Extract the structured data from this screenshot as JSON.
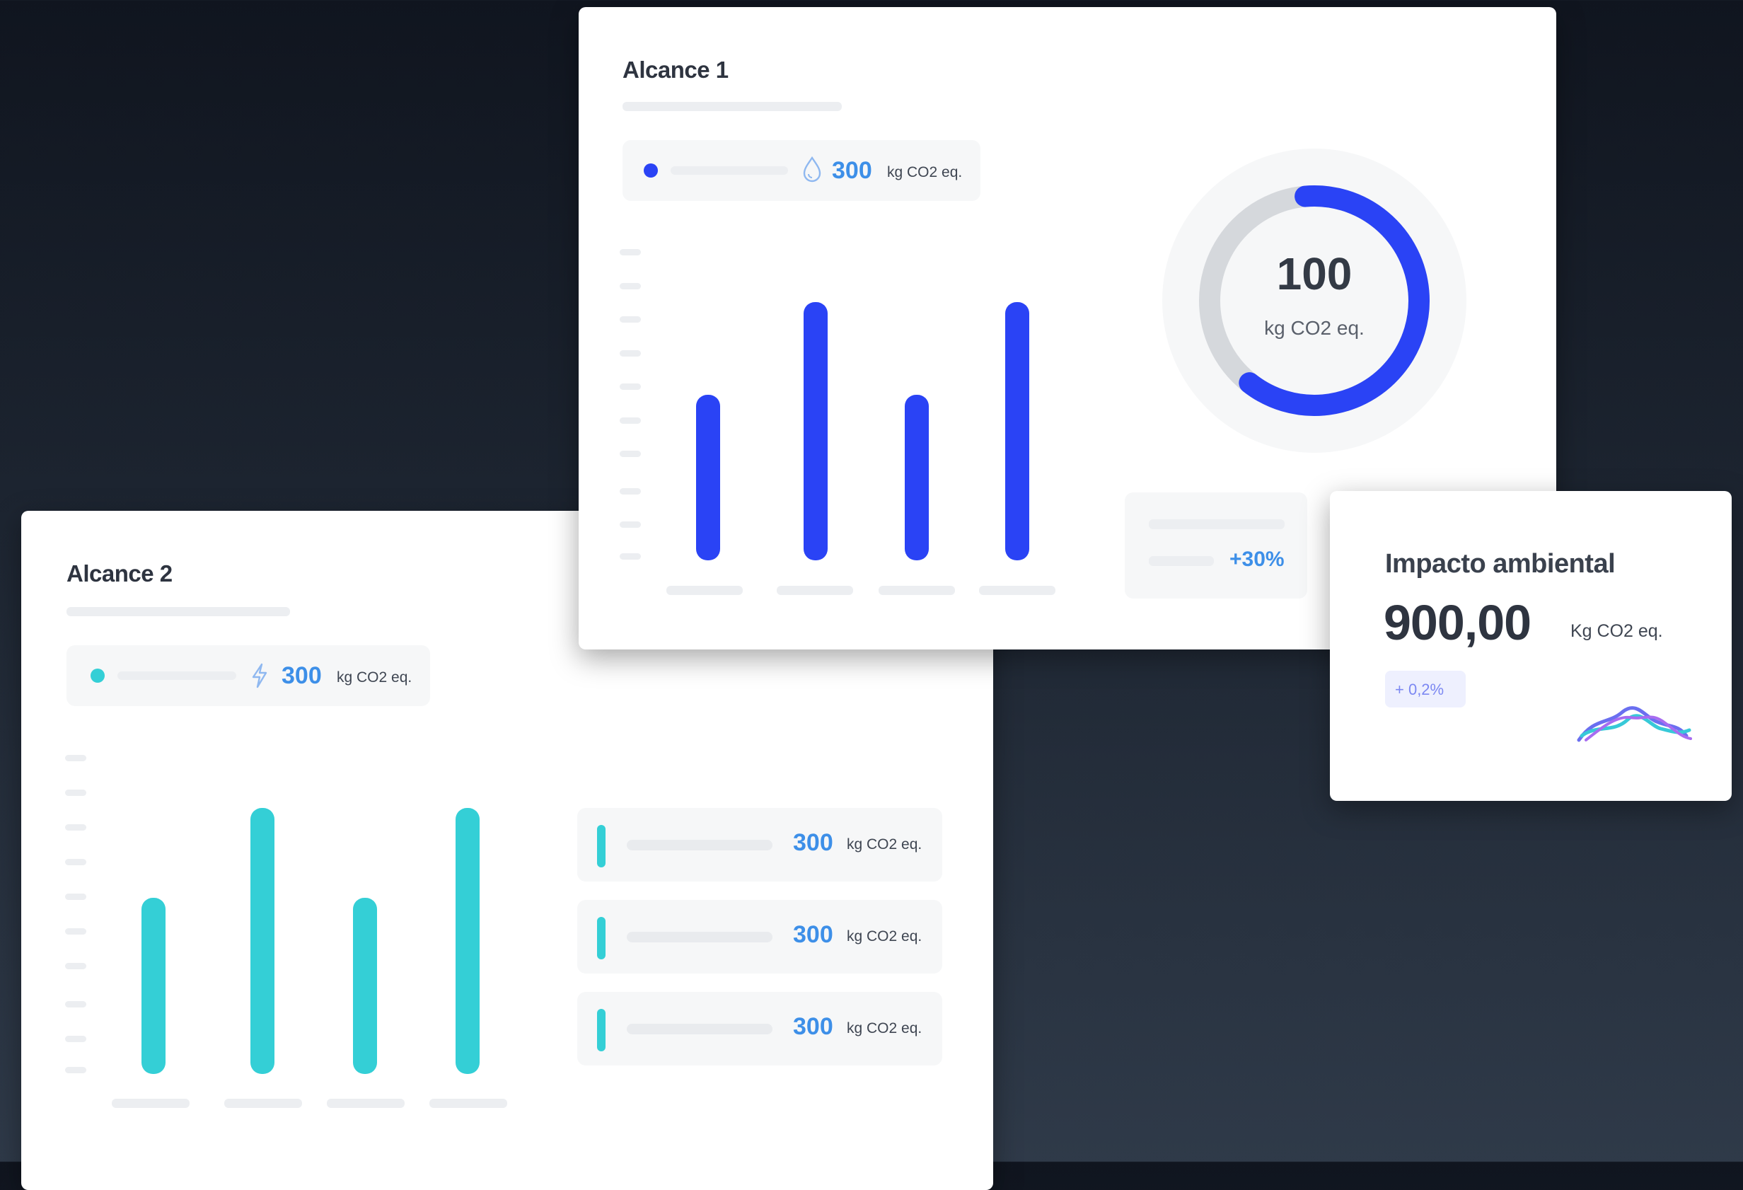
{
  "scope2": {
    "title": "Alcance 2",
    "legend_value": "300",
    "legend_unit": "kg CO2 eq.",
    "legend_icon": "bolt-icon",
    "rows": [
      {
        "value": "300",
        "unit": "kg CO2 eq."
      },
      {
        "value": "300",
        "unit": "kg CO2 eq."
      },
      {
        "value": "300",
        "unit": "kg CO2 eq."
      }
    ]
  },
  "scope1": {
    "title": "Alcance 1",
    "legend_value": "300",
    "legend_unit": "kg CO2 eq.",
    "legend_icon": "drop-icon",
    "donut_value": "100",
    "donut_unit": "kg CO2 eq.",
    "donut_progress": 0.62,
    "change": "+30%"
  },
  "impact": {
    "title": "Impacto ambiental",
    "value": "900,00",
    "unit": "Kg CO2 eq.",
    "change": "+ 0,2%",
    "sparkline_icon": "sparkline-icon"
  },
  "colors": {
    "scope1": "#2a43f5",
    "scope2": "#34cfd6",
    "accent_text": "#3d8fe8",
    "ring_track": "#d5d8dc"
  },
  "chart_data": [
    {
      "type": "bar",
      "series": [
        {
          "values": [
            50,
            78,
            50,
            78
          ]
        }
      ],
      "categories": [
        "",
        "",
        "",
        ""
      ],
      "ylim": [
        0,
        100
      ],
      "color": "#2a43f5"
    },
    {
      "type": "bar",
      "series": [
        {
          "values": [
            53,
            80,
            53,
            80
          ]
        }
      ],
      "categories": [
        "",
        "",
        "",
        ""
      ],
      "ylim": [
        0,
        100
      ],
      "color": "#34cfd6"
    }
  ]
}
